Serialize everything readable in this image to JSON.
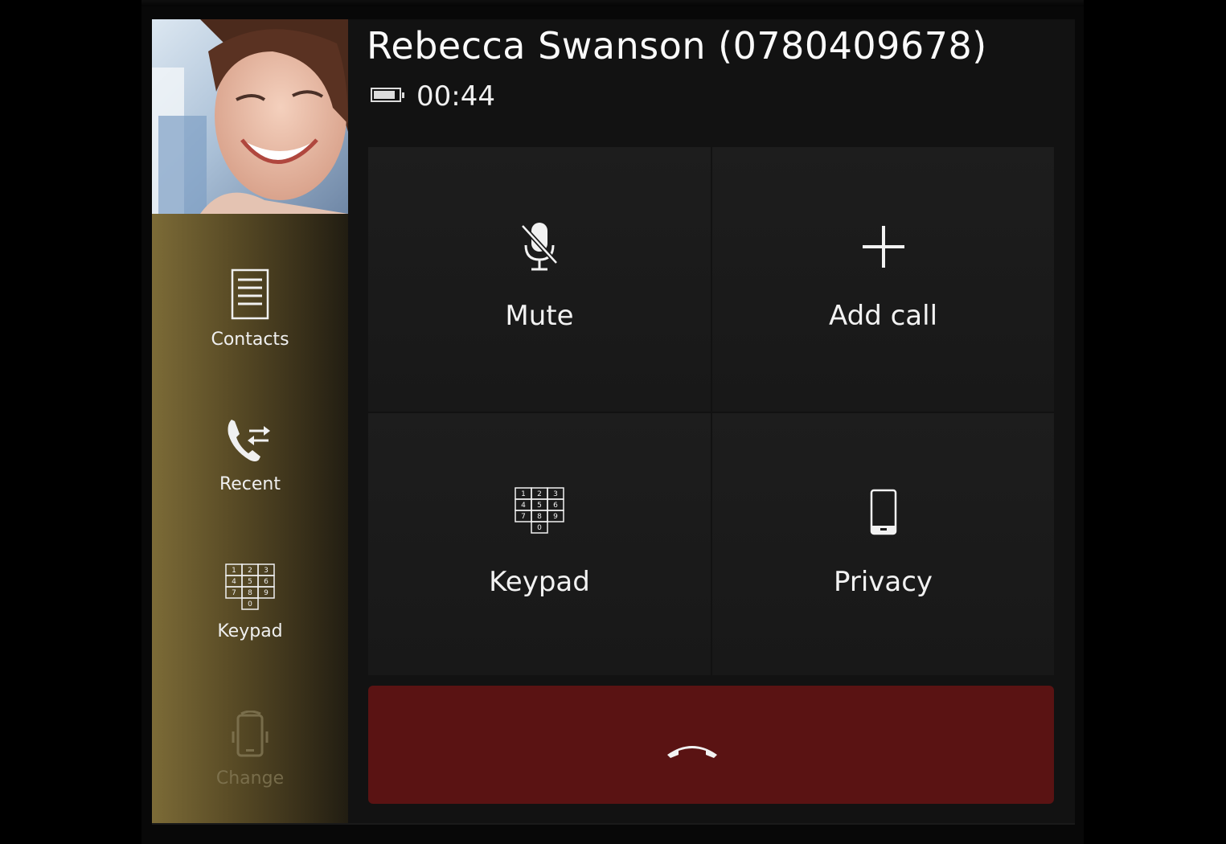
{
  "call": {
    "caller_name": "Rebecca Swanson (0780409678)",
    "duration": "00:44"
  },
  "sidebar": {
    "items": [
      {
        "label": "Contacts",
        "icon": "contacts-list-icon",
        "enabled": true
      },
      {
        "label": "Recent",
        "icon": "recent-calls-icon",
        "enabled": true
      },
      {
        "label": "Keypad",
        "icon": "keypad-icon",
        "enabled": true
      },
      {
        "label": "Change",
        "icon": "change-device-icon",
        "enabled": false
      }
    ]
  },
  "actions": {
    "mute": "Mute",
    "add_call": "Add call",
    "keypad": "Keypad",
    "privacy": "Privacy"
  },
  "keypad_digits": [
    "1",
    "2",
    "3",
    "4",
    "5",
    "6",
    "7",
    "8",
    "9",
    "0"
  ],
  "colors": {
    "sidebar_gold": "#7c6b37",
    "end_call_red": "#5a1313",
    "tile_bg": "#1b1b1b"
  }
}
